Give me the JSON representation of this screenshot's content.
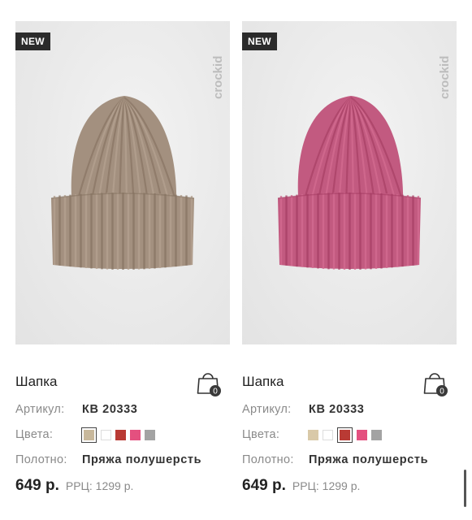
{
  "products": [
    {
      "badge": "NEW",
      "brand": "crockid",
      "title": "Шапка",
      "cart_count": "0",
      "article_label": "Артикул:",
      "article_value": "КВ 20333",
      "colors_label": "Цвета:",
      "colors": [
        "#c8b89b",
        "#ffffff",
        "#b93a34",
        "#e4507f",
        "#a3a3a3"
      ],
      "selected_color_index": 0,
      "fabric_label": "Полотно:",
      "fabric_value": "Пряжа полушерсть",
      "price": "649 р.",
      "rrc": "РРЦ: 1299 р.",
      "hat_color": "#a3907f"
    },
    {
      "badge": "NEW",
      "brand": "crockid",
      "title": "Шапка",
      "cart_count": "0",
      "article_label": "Артикул:",
      "article_value": "КВ 20333",
      "colors_label": "Цвета:",
      "colors": [
        "#d9c9a8",
        "#ffffff",
        "#b93a34",
        "#e4507f",
        "#a3a3a3"
      ],
      "selected_color_index": 2,
      "fabric_label": "Полотно:",
      "fabric_value": "Пряжа полушерсть",
      "price": "649 р.",
      "rrc": "РРЦ: 1299 р.",
      "hat_color": "#c25a80"
    }
  ]
}
